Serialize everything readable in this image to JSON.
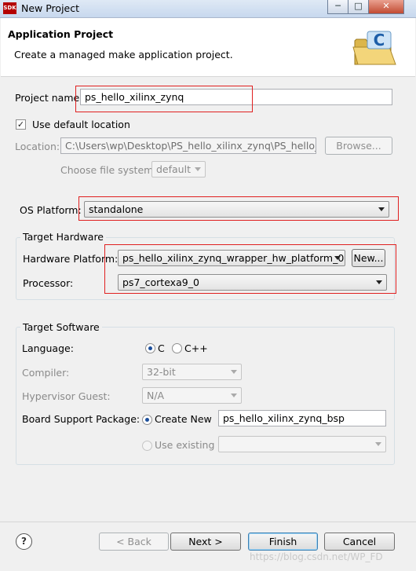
{
  "window": {
    "icon_text": "SDK",
    "title": "New Project",
    "controls": {
      "minimize": "─",
      "maximize": "□",
      "close": "✕"
    }
  },
  "header": {
    "title": "Application Project",
    "description": "Create a managed make application project.",
    "icon": "folder-c-icon"
  },
  "project": {
    "name_label": "Project name:",
    "name_value": "ps_hello_xilinx_zynq",
    "use_default_label": "Use default location",
    "use_default_checked": true,
    "location_label": "Location:",
    "location_value": "C:\\Users\\wp\\Desktop\\PS_hello_xilinx_zynq\\PS_hello_xilin",
    "browse_label": "Browse...",
    "file_system_label": "Choose file system:",
    "file_system_value": "default"
  },
  "os": {
    "label": "OS Platform:",
    "value": "standalone"
  },
  "target_hardware": {
    "group_title": "Target Hardware",
    "platform_label": "Hardware Platform:",
    "platform_value": "ps_hello_xilinx_zynq_wrapper_hw_platform_0",
    "new_label": "New...",
    "processor_label": "Processor:",
    "processor_value": "ps7_cortexa9_0"
  },
  "target_software": {
    "group_title": "Target Software",
    "language_label": "Language:",
    "lang_c": "C",
    "lang_cpp": "C++",
    "selected_language": "C",
    "compiler_label": "Compiler:",
    "compiler_value": "32-bit",
    "hypervisor_label": "Hypervisor Guest:",
    "hypervisor_value": "N/A",
    "bsp_label": "Board Support Package:",
    "create_new_label": "Create New",
    "bsp_name": "ps_hello_xilinx_zynq_bsp",
    "use_existing_label": "Use existing",
    "existing_value": ""
  },
  "footer": {
    "help_label": "?",
    "back_label": "< Back",
    "next_label": "Next >",
    "finish_label": "Finish",
    "cancel_label": "Cancel"
  },
  "watermark": "https://blog.csdn.net/WP_FD",
  "colors": {
    "highlight_box": "#e02020",
    "title_bar": "#c7d8ee",
    "banner": "#ffffff"
  }
}
